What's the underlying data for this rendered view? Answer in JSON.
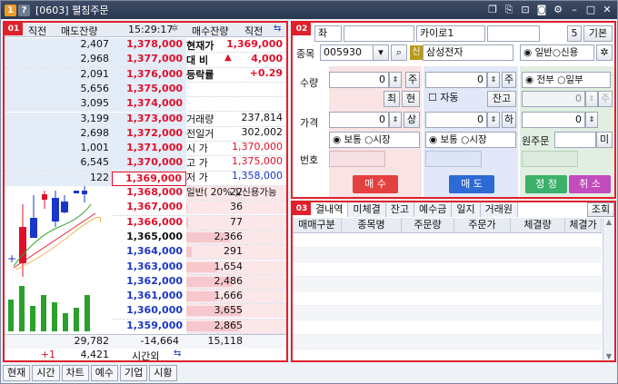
{
  "window": {
    "number": "1",
    "help": "?",
    "title": "[0603] 펼침주문"
  },
  "titlebar_icons": [
    "window-icon",
    "copy-icon",
    "link-icon",
    "camera-icon",
    "settings-icon",
    "minimize-icon",
    "maximize-icon",
    "close-icon"
  ],
  "panel1": {
    "badge": "01",
    "header": {
      "prev": "직전",
      "ask_vol": "매도잔량",
      "time": "15:29:17",
      "bid_vol": "매수잔량",
      "prev2": "직전"
    },
    "asks": [
      {
        "vol": "2,407",
        "price": "1,378,000"
      },
      {
        "vol": "2,968",
        "price": "1,377,000"
      },
      {
        "vol": "2,091",
        "price": "1,376,000"
      },
      {
        "vol": "5,656",
        "price": "1,375,000"
      },
      {
        "vol": "3,095",
        "price": "1,374,000"
      },
      {
        "vol": "3,199",
        "price": "1,373,000"
      },
      {
        "vol": "2,698",
        "price": "1,372,000"
      },
      {
        "vol": "1,001",
        "price": "1,371,000"
      },
      {
        "vol": "6,545",
        "price": "1,370,000"
      },
      {
        "vol": "122",
        "price": "1,369,000"
      }
    ],
    "bids": [
      {
        "price": "1,368,000",
        "vol": "22",
        "level": 0.01
      },
      {
        "price": "1,367,000",
        "vol": "36",
        "level": 0.01
      },
      {
        "price": "1,366,000",
        "vol": "77",
        "level": 0.03
      },
      {
        "price": "1,365,000",
        "vol": "2,366",
        "level": 0.8
      },
      {
        "price": "1,364,000",
        "vol": "291",
        "level": 0.1
      },
      {
        "price": "1,363,000",
        "vol": "1,654",
        "level": 0.57
      },
      {
        "price": "1,362,000",
        "vol": "2,486",
        "level": 0.85
      },
      {
        "price": "1,361,000",
        "vol": "1,666",
        "level": 0.57
      },
      {
        "price": "1,360,000",
        "vol": "3,655",
        "level": 1.0
      },
      {
        "price": "1,359,000",
        "vol": "2,865",
        "level": 0.95
      }
    ],
    "info": {
      "current_label": "현재가",
      "current_value": "1,369,000",
      "change_label": "대  비",
      "change_arrow": "▲",
      "change_value": "4,000",
      "rate_label": "등락률",
      "rate_value": "+0.29",
      "volume_label": "거래량",
      "volume_value": "237,814",
      "prev_vol_label": "전일거",
      "prev_vol_value": "302,002",
      "open_label": "시  가",
      "open_value": "1,370,000",
      "high_label": "고  가",
      "high_value": "1,375,000",
      "low_label": "저  가",
      "low_value": "1,358,000",
      "margin_text": "일반( 20% )/신용가능"
    },
    "totals": {
      "ask_total": "29,782",
      "diff": "-14,664",
      "bid_total": "15,118"
    },
    "after_hours": {
      "change": "+1",
      "vol": "4,421",
      "label": "시간외"
    }
  },
  "bottom_tabs": [
    "현재",
    "시간",
    "차트",
    "예수",
    "기업",
    "시황"
  ],
  "panel2": {
    "badge": "02",
    "account_name": "카이로1",
    "spinner_value": "5",
    "basic_button": "기본",
    "stock_label": "종목",
    "stock_code": "005930",
    "credit_badge": "신",
    "stock_name": "삼성전자",
    "radio_general": "일반",
    "radio_credit": "신용",
    "qty_label": "수량",
    "price_label": "가격",
    "number_label": "번호",
    "sell_qty": "0",
    "buy_qty": "0",
    "main_btn": "주",
    "max_btn": "최",
    "current_btn": "현",
    "auto_label": "자동",
    "balance_btn": "잔고",
    "sell_price": "0",
    "buy_price": "0",
    "upper_btn": "상",
    "lower_btn": "하",
    "normal_label": "보통",
    "market_label": "시장",
    "all_label": "전부",
    "part_label": "일부",
    "mod_qty": "0",
    "mod_price": "0",
    "mod_price2": "0",
    "orig_label": "원주문",
    "mi_btn": "미",
    "sell_button": "매  수",
    "buy_button": "매  도",
    "modify_button": "정  정",
    "cancel_button": "취  소"
  },
  "panel3": {
    "badge": "03",
    "tabs": [
      "결내역",
      "미체결",
      "잔고",
      "예수금",
      "일지",
      "거래원"
    ],
    "query_button": "조회",
    "columns": [
      "매매구분",
      "종목명",
      "주문량",
      "주문가",
      "체결량",
      "체결가"
    ]
  },
  "colors": {
    "accent_red": "#e0202a",
    "up_red": "#e0102a",
    "down_blue": "#1a36c8"
  }
}
